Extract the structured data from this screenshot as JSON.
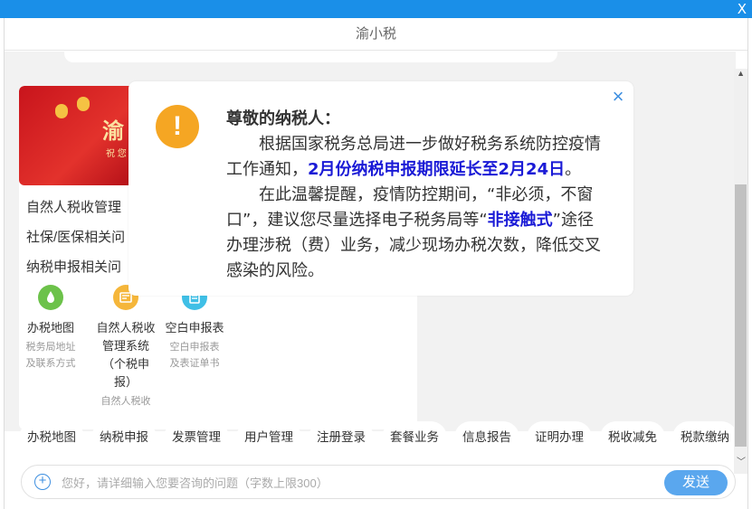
{
  "window": {
    "close_label": "X",
    "title": "渝小税"
  },
  "banner": {
    "big_text": "渝",
    "small_text": "祝 您"
  },
  "links": [
    "自然人税收管理",
    "社保/医保相关问",
    "纳税申报相关问"
  ],
  "services": [
    {
      "name": "办税地图",
      "desc": "税务局地址及联系方式",
      "color": "#6cc24a"
    },
    {
      "name": "自然人税收管理系统（个税申报）",
      "desc": "自然人税收",
      "color": "#f5b63a"
    },
    {
      "name": "空白申报表",
      "desc": "空白申报表及表证单书",
      "color": "#3fbfe6"
    }
  ],
  "popup": {
    "greeting": "尊敬的纳税人：",
    "p1_pre": "根据国家税务总局进一步做好税务系统防控疫情工作通知，",
    "p1_hl": "2月份纳税申报期限延长至2月24日",
    "p1_post": "。",
    "p2_pre": "在此温馨提醒，疫情防控期间，“非必须，不窗口”，建议您尽量选择电子税务局等“",
    "p2_hl": "非接触式",
    "p2_post": "”途径办理涉税（费）业务，减少现场办税次数，降低交叉感染的风险。",
    "close_icon": "×"
  },
  "quick_buttons": [
    "办税地图",
    "纳税申报",
    "发票管理",
    "用户管理",
    "注册登录",
    "套餐业务",
    "信息报告",
    "证明办理",
    "税收减免",
    "税款缴纳"
  ],
  "input": {
    "placeholder": "您好，请详细输入您要咨询的问题（字数上限300）",
    "value": ""
  },
  "send_label": "发送",
  "colors": {
    "accent": "#1a8fe8",
    "highlight": "#1a1ad6",
    "warning": "#f5a623"
  }
}
